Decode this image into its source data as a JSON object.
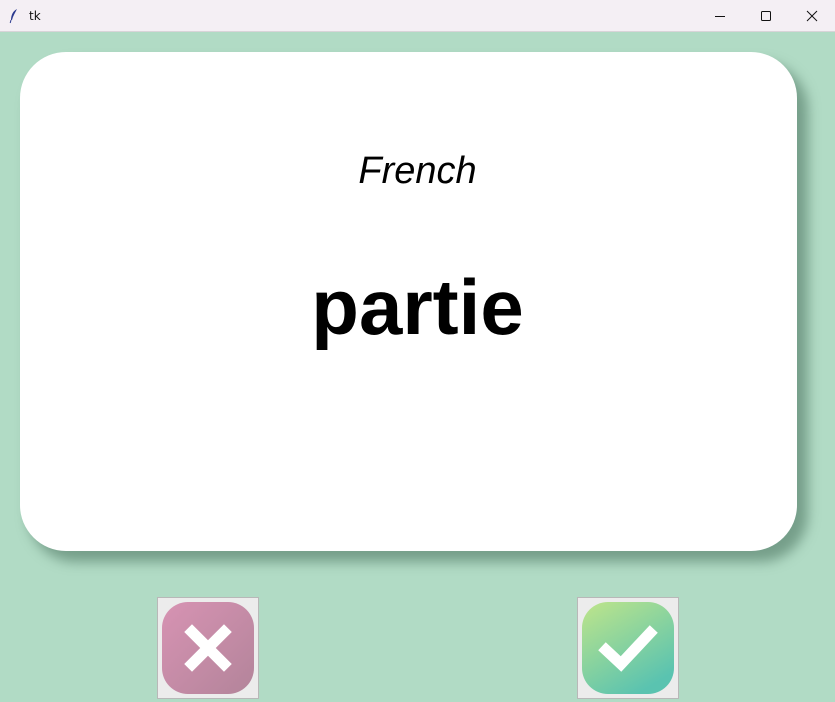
{
  "window": {
    "title": "tk",
    "app_icon": "tk-feather-icon",
    "controls": [
      "minimize-icon",
      "maximize-icon",
      "close-icon"
    ]
  },
  "card": {
    "language": "French",
    "word": "partie",
    "background": "#ffffff"
  },
  "buttons": {
    "wrong": {
      "icon": "x-mark-icon",
      "color": "#c78ca6"
    },
    "right": {
      "icon": "check-mark-icon",
      "color": "#7ccf9a"
    }
  },
  "colors": {
    "background": "#b1dbc5"
  }
}
